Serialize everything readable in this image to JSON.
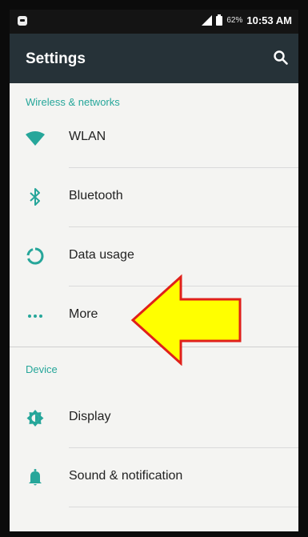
{
  "status_bar": {
    "battery": "62%",
    "time": "10:53 AM"
  },
  "app_bar": {
    "title": "Settings",
    "search_icon": "search-icon"
  },
  "sections": [
    {
      "header": "Wireless & networks",
      "items": [
        {
          "label": "WLAN",
          "icon": "wifi-icon"
        },
        {
          "label": "Bluetooth",
          "icon": "bluetooth-icon"
        },
        {
          "label": "Data usage",
          "icon": "data-usage-icon"
        },
        {
          "label": "More",
          "icon": "more-icon"
        }
      ]
    },
    {
      "header": "Device",
      "items": [
        {
          "label": "Display",
          "icon": "brightness-icon"
        },
        {
          "label": "Sound & notification",
          "icon": "bell-icon"
        }
      ]
    }
  ],
  "annotation": {
    "icon": "arrow-left-icon",
    "target": "More",
    "fill_color": "#ffff00",
    "outline_color": "#e0201a"
  },
  "colors": {
    "app_bar": "#263238",
    "accent": "#26a69a",
    "background": "#f4f4f2"
  }
}
